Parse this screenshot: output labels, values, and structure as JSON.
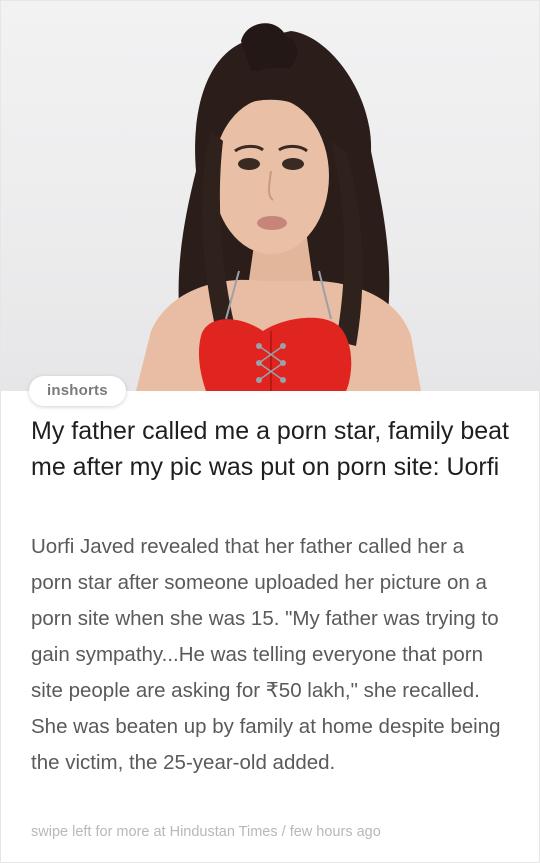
{
  "brand": {
    "tag": "inshorts"
  },
  "article": {
    "headline": "My father called me a porn star, family beat me after my pic was put on porn site: Uorfi",
    "body": "Uorfi Javed revealed that her father called her a porn star after someone uploaded her picture on a porn site when she was 15. \"My father was trying to gain sympathy...He was telling everyone that porn site people are asking for ₹50 lakh,\" she recalled. She was beaten up by family at home despite being the victim, the 25-year-old added."
  },
  "footer": {
    "prefix": "swipe left for more at",
    "source": "Hindustan Times",
    "separator": "/",
    "time": "few hours ago"
  }
}
